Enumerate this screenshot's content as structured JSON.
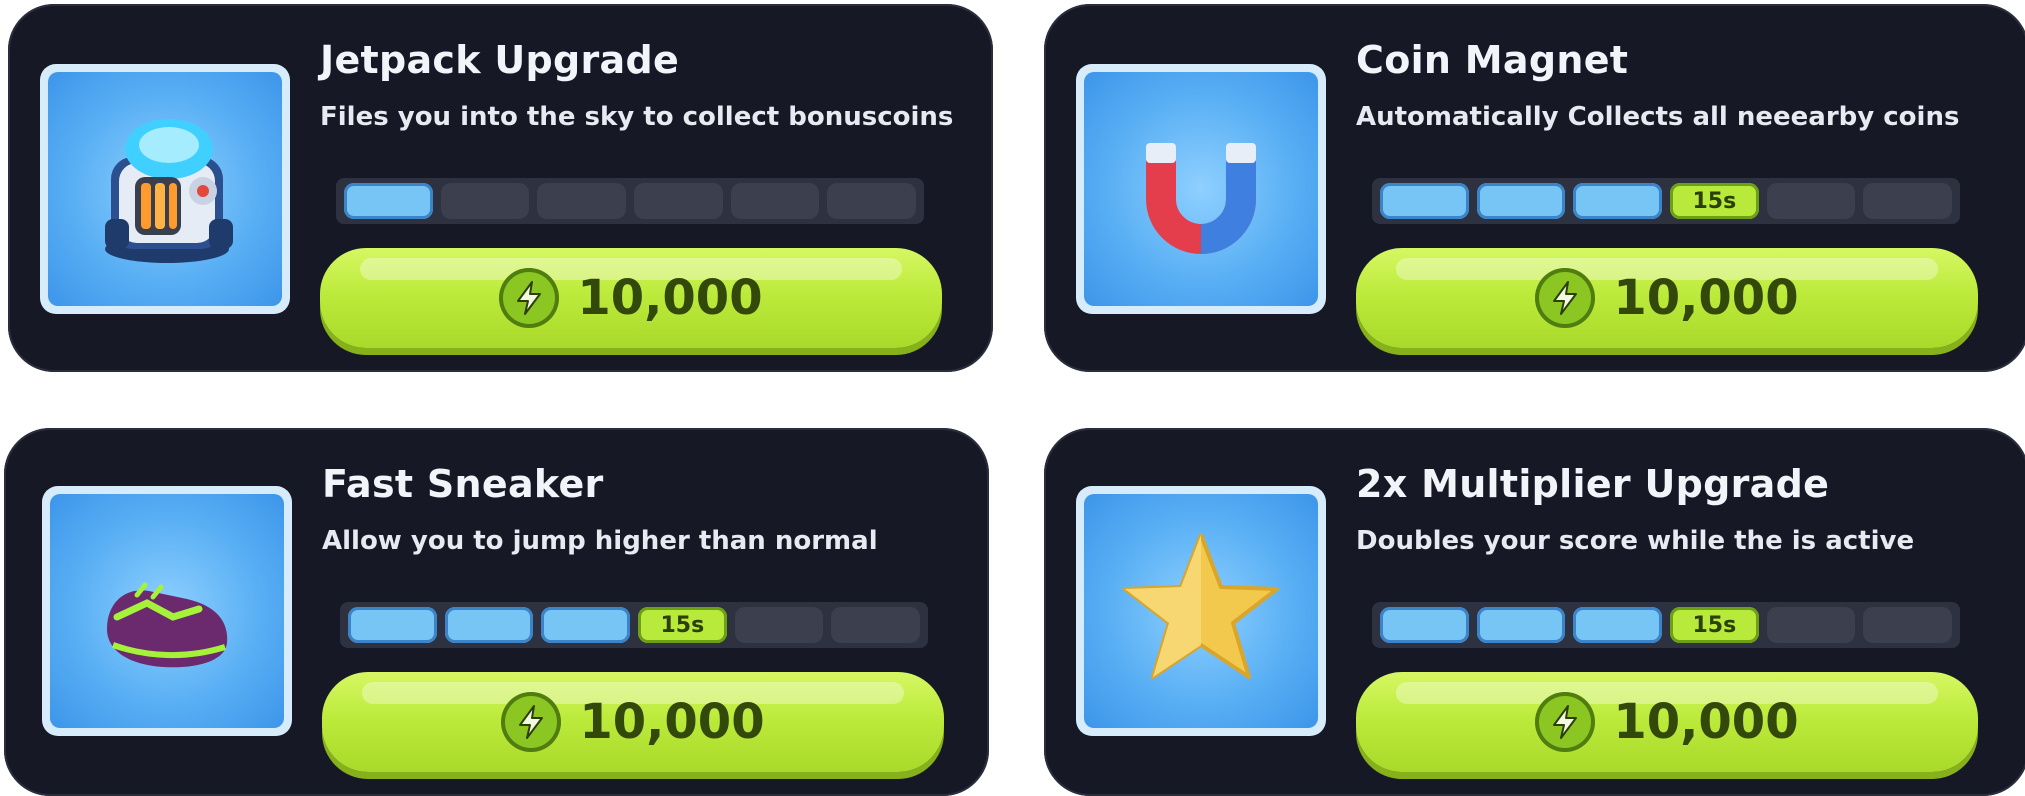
{
  "cards": [
    {
      "title": "Jetpack Upgrade",
      "description": "Files you into the sky to collect bonuscoins",
      "icon": "jetpack-icon",
      "progress": {
        "filled": 1,
        "total": 6,
        "timer": ""
      },
      "price": "10,000"
    },
    {
      "title": "Coin Magnet",
      "description": "Automatically Collects all neeearby coins",
      "icon": "magnet-icon",
      "progress": {
        "filled": 3,
        "total": 6,
        "timer": "15s"
      },
      "price": "10,000"
    },
    {
      "title": "Fast Sneaker",
      "description": "Allow you to jump higher than normal",
      "icon": "sneaker-icon",
      "progress": {
        "filled": 3,
        "total": 6,
        "timer": "15s"
      },
      "price": "10,000"
    },
    {
      "title": "2x Multiplier Upgrade",
      "description": "Doubles your score while the  is active",
      "icon": "star-icon",
      "progress": {
        "filled": 3,
        "total": 6,
        "timer": "15s"
      },
      "price": "10,000"
    }
  ],
  "colors": {
    "card_bg": "#161925",
    "button_green": "#bdeb3c",
    "segment_blue": "#77c5f5",
    "thumb_blue": "#5ab0f4"
  }
}
